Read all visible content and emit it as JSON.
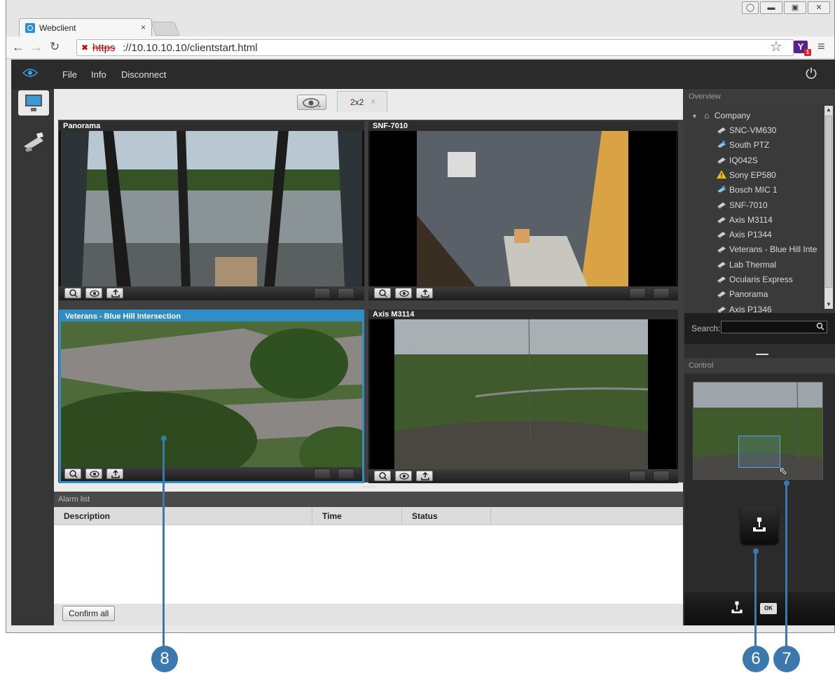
{
  "browser": {
    "tab_title": "Webclient",
    "tab_close": "×",
    "url_scheme": "https",
    "url_rest": "://10.10.10.10/clientstart.html",
    "window_controls": [
      "minimize",
      "maximize",
      "close"
    ]
  },
  "app": {
    "menu": [
      "File",
      "Info",
      "Disconnect"
    ],
    "layout_tab": "2x2",
    "layout_tab_close": "x"
  },
  "tiles": [
    {
      "title": "Panorama",
      "selected": false
    },
    {
      "title": "SNF-7010",
      "selected": false
    },
    {
      "title": "Veterans - Blue Hill Intersection",
      "selected": true
    },
    {
      "title": "Axis M3114",
      "selected": false
    }
  ],
  "alarm": {
    "header": "Alarm list",
    "columns": [
      "Description",
      "Time",
      "Status"
    ],
    "confirm_label": "Confirm all"
  },
  "overview": {
    "header": "Overview",
    "root": "Company",
    "items": [
      {
        "label": "SNC-VM630",
        "icon": "camera-icon"
      },
      {
        "label": "South PTZ",
        "icon": "ptz-camera-icon"
      },
      {
        "label": "IQ042S",
        "icon": "camera-icon"
      },
      {
        "label": "Sony EP580",
        "icon": "warning-icon"
      },
      {
        "label": "Bosch MIC 1",
        "icon": "ptz-camera-icon"
      },
      {
        "label": "SNF-7010",
        "icon": "camera-icon"
      },
      {
        "label": "Axis M3114",
        "icon": "camera-icon"
      },
      {
        "label": "Axis P1344",
        "icon": "camera-icon"
      },
      {
        "label": "Veterans - Blue Hill Inte",
        "icon": "camera-icon"
      },
      {
        "label": "Lab Thermal",
        "icon": "camera-icon"
      },
      {
        "label": "Ocularis Express",
        "icon": "camera-icon"
      },
      {
        "label": "Panorama",
        "icon": "camera-icon"
      },
      {
        "label": "Axis P1346",
        "icon": "camera-icon"
      }
    ],
    "search_label": "Search:",
    "search_value": ""
  },
  "control": {
    "header": "Control",
    "ok_label": "OK"
  },
  "callouts": [
    "8",
    "6",
    "7"
  ],
  "colors": {
    "accent": "#2f8ec5",
    "callout": "#3b78ad",
    "warning": "#f2c200"
  }
}
